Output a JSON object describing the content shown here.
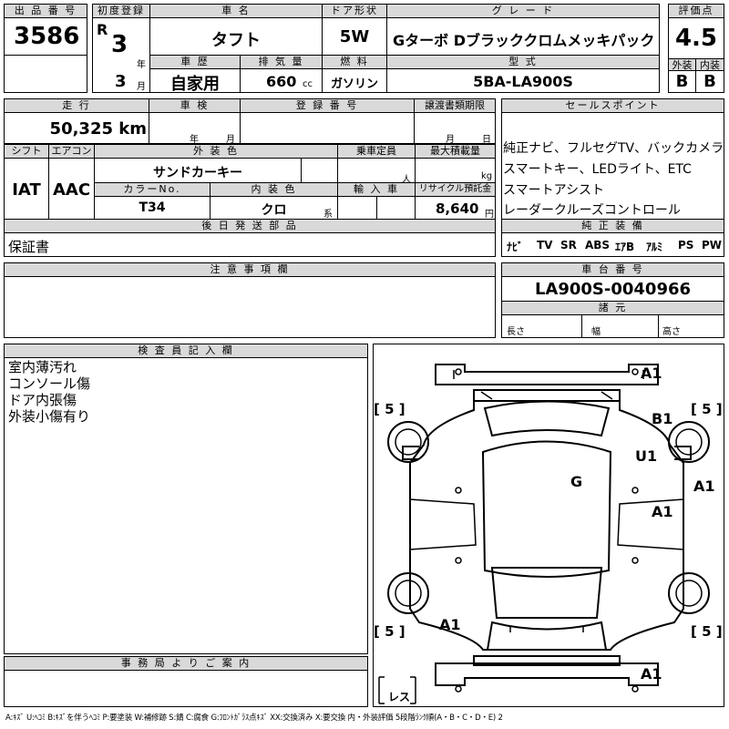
{
  "row1": {
    "lot_header": "出 品 番 号",
    "lot_no": "3586",
    "first_reg_header": "初度登録",
    "era": "R",
    "year": "3",
    "year_unit": "年",
    "month": "3",
    "month_unit": "月",
    "car_name_header": "車 名",
    "car_name": "タフト",
    "door_header": "ドア形状",
    "door": "5W",
    "grade_header": "グ レ ー ド",
    "grade": "Gターボ Dブラッククロムメッキパック",
    "score_header": "評価点",
    "score": "4.5",
    "history_header": "車 歴",
    "history": "自家用",
    "displacement_header": "排 気 量",
    "displacement": "660",
    "displacement_unit": "cc",
    "fuel_header": "燃 料",
    "fuel": "ガソリン",
    "model_header": "型 式",
    "model": "5BA-LA900S",
    "exterior_header": "外装",
    "exterior": "B",
    "interior_header": "内装",
    "interior": "B"
  },
  "row2": {
    "mileage_header": "走 行",
    "mileage": "50,325 km",
    "inspection_header": "車 検",
    "inspection_year": "年",
    "inspection_month": "月",
    "reg_no_header": "登 録 番 号",
    "transfer_header": "譲渡書類期限",
    "transfer_month": "月",
    "transfer_day": "日",
    "sales_header": "セールスポイント",
    "sales_points": [
      "純正ナビ、フルセグTV、バックカメラ",
      "スマートキー、LEDライト、ETC",
      "スマートアシスト",
      "レーダークルーズコントロール"
    ]
  },
  "row3": {
    "shift_header": "シフト",
    "shift": "IAT",
    "ac_header": "エアコン",
    "ac": "AAC",
    "ext_color_header": "外 装 色",
    "ext_color": "サンドカーキー",
    "capacity_header": "乗車定員",
    "capacity_unit": "人",
    "load_header": "最大積載量",
    "load_unit": "kg",
    "color_no_header": "カラーNo.",
    "color_no": "T34",
    "int_color_header": "内 装 色",
    "int_color": "クロ",
    "int_color_unit": "系",
    "import_header": "輸 入 車",
    "recycle_header": "リサイクル預託金",
    "recycle": "8,640",
    "recycle_unit": "円"
  },
  "later_items": {
    "header": "後 日 発 送 部 品",
    "value": "保証書"
  },
  "equipment": {
    "header": "純 正 装 備",
    "items": [
      "ﾅﾋﾞ",
      "TV",
      "SR",
      "ABS",
      "ｴｱB",
      "ｱﾙﾐ",
      "PS",
      "PW"
    ]
  },
  "notes": {
    "header": "注 意 事 項 欄"
  },
  "chassis": {
    "header": "車 台 番 号",
    "value": "LA900S-0040966",
    "spec_header": "諸 元",
    "length": "長さ",
    "width": "幅",
    "height": "高さ"
  },
  "inspector": {
    "header": "検 査 員 記 入 欄",
    "lines": [
      "室内薄汚れ",
      "コンソール傷",
      "ドア内張傷",
      "外装小傷有り"
    ]
  },
  "office": {
    "header": "事 務 局 よ り ご 案 内"
  },
  "diagram": {
    "marks": [
      "A1",
      "B1",
      "U1",
      "A1",
      "G",
      "A1",
      "A1",
      "A1"
    ],
    "tires": [
      "5",
      "5",
      "5",
      "5"
    ],
    "spare": "レス"
  },
  "legend": "A:ｷｽﾞ U:ﾍｺﾐ B:ｷｽﾞを伴うﾍｺﾐ P:要塗装 W:補修跡 S:錆 C:腐食 G:ﾌﾛﾝﾄｶﾞﾗｽ点ｷｽﾞ XX:交換済み X:要交換 内・外装評価 5段階ﾗﾝｸ順(A・B・C・D・E) 2"
}
